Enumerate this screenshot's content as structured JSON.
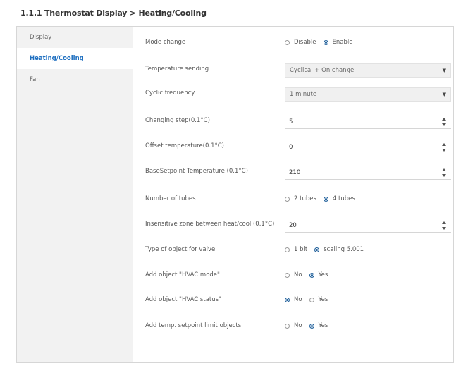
{
  "title": "1.1.1 Thermostat Display > Heating/Cooling",
  "sidebar": {
    "items": [
      {
        "label": "Display"
      },
      {
        "label": "Heating/Cooling"
      },
      {
        "label": "Fan"
      }
    ]
  },
  "form": {
    "mode_change": {
      "label": "Mode change",
      "opt1": "Disable",
      "opt2": "Enable"
    },
    "temperature_sending": {
      "label": "Temperature sending",
      "value": "Cyclical + On change"
    },
    "cyclic_frequency": {
      "label": "Cyclic frequency",
      "value": "1 minute"
    },
    "changing_step": {
      "label": "Changing step(0.1°C)",
      "value": "5"
    },
    "offset_temperature": {
      "label": "Offset temperature(0.1°C)",
      "value": "0"
    },
    "base_setpoint": {
      "label": "BaseSetpoint Temperature (0.1°C)",
      "value": "210"
    },
    "number_of_tubes": {
      "label": "Number of tubes",
      "opt1": "2 tubes",
      "opt2": "4 tubes"
    },
    "insensitive_zone": {
      "label": "Insensitive zone between heat/cool (0.1°C)",
      "value": "20"
    },
    "type_of_object": {
      "label": "Type of object for valve",
      "opt1": "1 bit",
      "opt2": "scaling 5.001"
    },
    "add_hvac_mode": {
      "label": "Add object \"HVAC mode\"",
      "opt1": "No",
      "opt2": "Yes"
    },
    "add_hvac_status": {
      "label": "Add object \"HVAC status\"",
      "opt1": "No",
      "opt2": "Yes"
    },
    "add_setpoint_limit": {
      "label": "Add temp. setpoint limit objects",
      "opt1": "No",
      "opt2": "Yes"
    }
  },
  "colors": {
    "accent": "#1e6fc0",
    "radio_selected": "#1f5f9a"
  }
}
